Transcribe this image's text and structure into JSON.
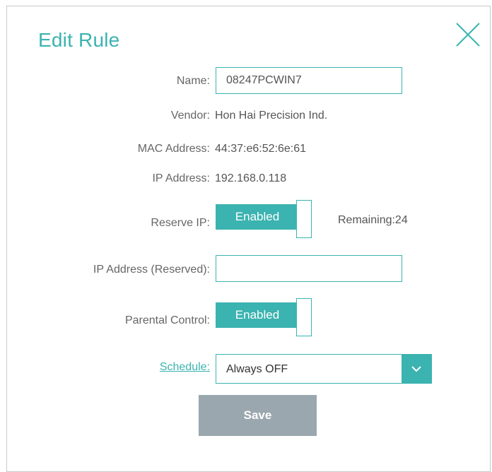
{
  "dialog": {
    "title": "Edit Rule",
    "close_icon": "close-icon"
  },
  "fields": {
    "name_label": "Name:",
    "name_value": "08247PCWIN7",
    "vendor_label": "Vendor:",
    "vendor_value": "Hon Hai Precision Ind.",
    "mac_label": "MAC Address:",
    "mac_value": "44:37:e6:52:6e:61",
    "ip_label": "IP Address:",
    "ip_value": "192.168.0.118",
    "reserve_label": "Reserve IP:",
    "reserve_state": "Enabled",
    "remaining_text": "Remaining:24",
    "ip_reserved_label": "IP Address (Reserved):",
    "ip_reserved_value": "",
    "parental_label": "Parental Control:",
    "parental_state": "Enabled",
    "schedule_label": "Schedule:",
    "schedule_value": "Always OFF"
  },
  "actions": {
    "save_label": "Save"
  },
  "colors": {
    "accent": "#3bb3b0",
    "save_bg": "#9aa7ae"
  }
}
